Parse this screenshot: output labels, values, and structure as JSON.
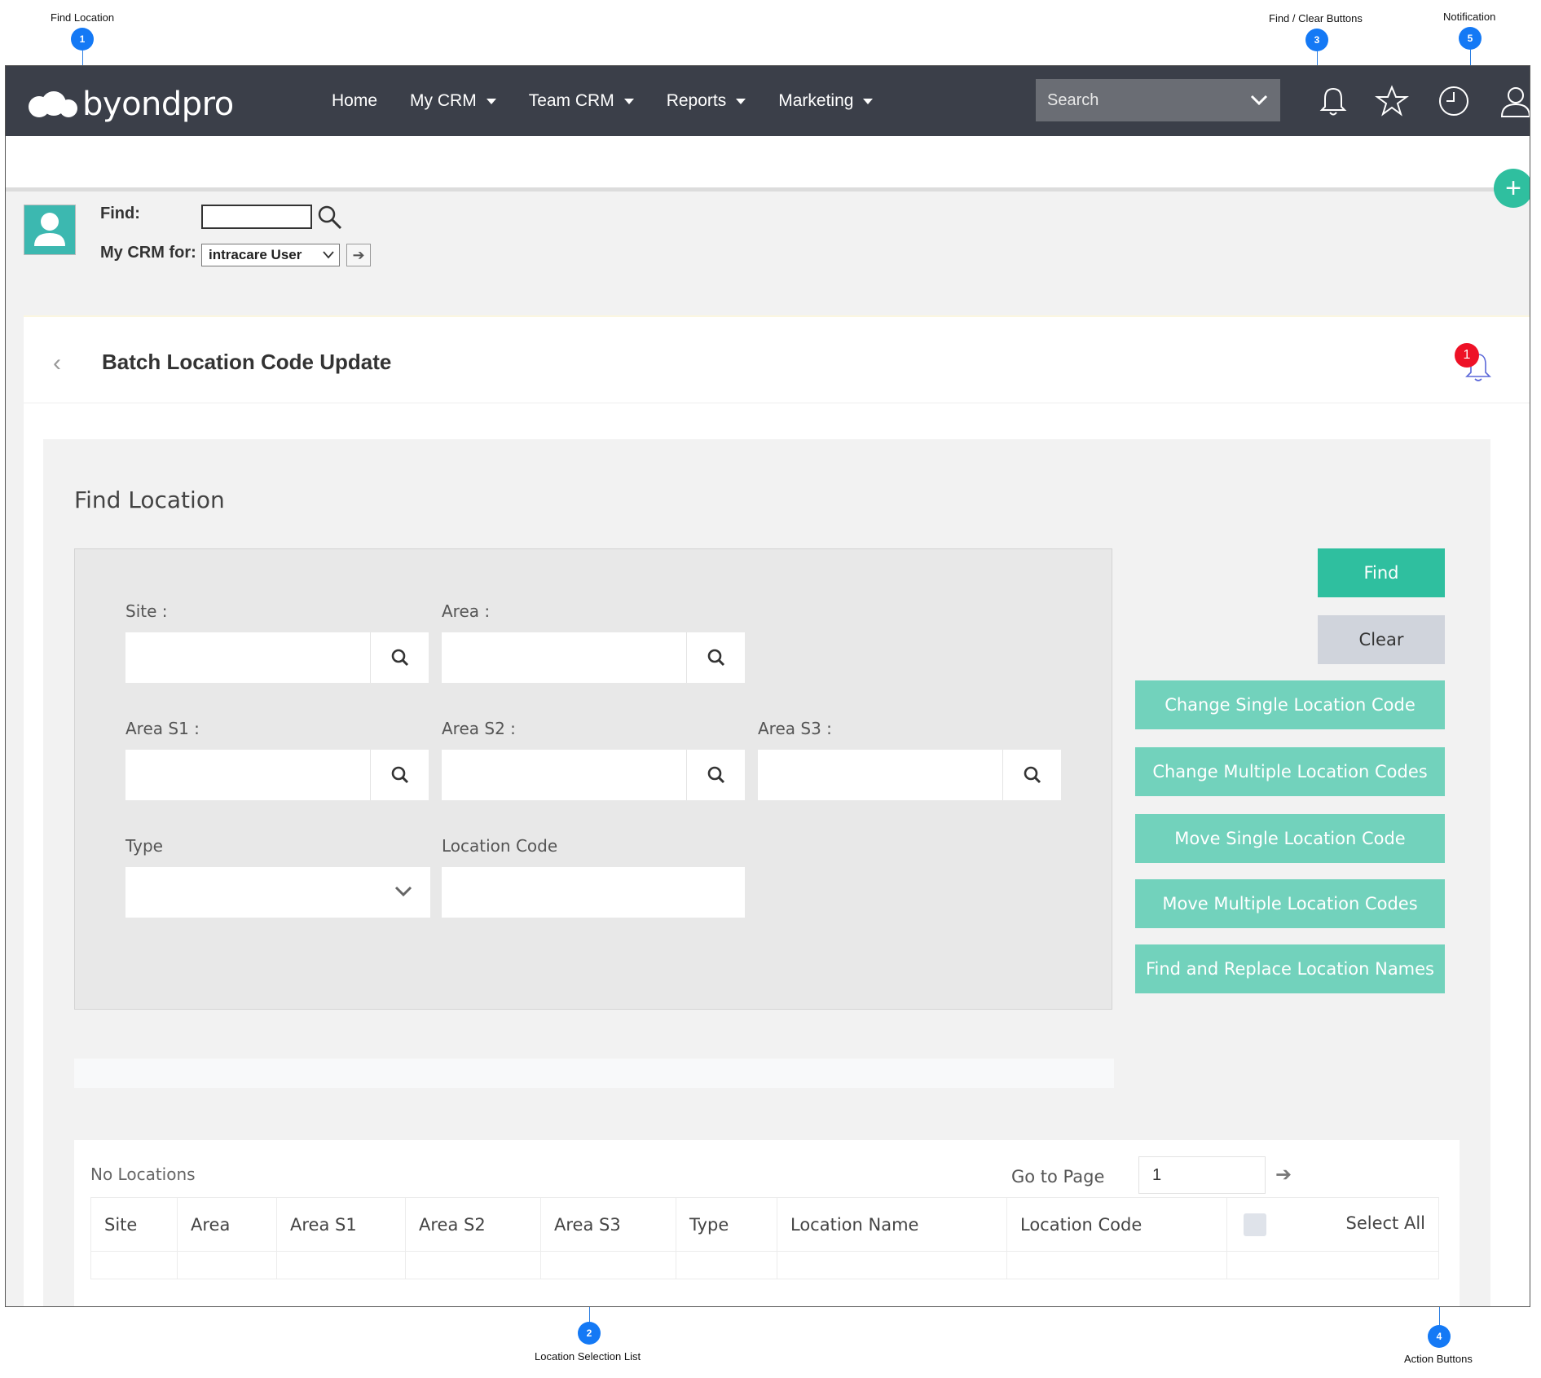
{
  "annotations": {
    "find_location": {
      "label": "Find Location",
      "num": "1"
    },
    "location_selection_list": {
      "label": "Location Selection List",
      "num": "2"
    },
    "find_clear_buttons": {
      "label": "Find  / Clear Buttons",
      "num": "3"
    },
    "action_buttons": {
      "label": "Action Buttons",
      "num": "4"
    },
    "notification": {
      "label": "Notification",
      "num": "5"
    }
  },
  "navbar": {
    "logo_text": "byondpro",
    "links": [
      "Home",
      "My CRM",
      "Team CRM",
      "Reports",
      "Marketing"
    ],
    "search_placeholder": "Search"
  },
  "toolbar": {
    "find_label": "Find:",
    "crm_for_label": "My CRM for:",
    "crm_for_value": "intracare User",
    "fab_icon": "plus-icon"
  },
  "page": {
    "title": "Batch Location Code Update",
    "notification_count": "1"
  },
  "find_location": {
    "title": "Find Location",
    "site_label": "Site :",
    "area_label": "Area :",
    "area_s1_label": "Area S1 :",
    "area_s2_label": "Area S2 :",
    "area_s3_label": "Area S3 :",
    "type_label": "Type",
    "location_code_label": "Location Code"
  },
  "buttons": {
    "find": "Find",
    "clear": "Clear",
    "change_single": "Change Single Location Code",
    "change_multiple": "Change Multiple Location Codes",
    "move_single": "Move Single Location Code",
    "move_multiple": "Move Multiple Location Codes",
    "find_replace": "Find and Replace Location Names"
  },
  "results": {
    "empty_text": "No Locations",
    "goto_label": "Go to Page",
    "page_value": "1",
    "columns": [
      "Site",
      "Area",
      "Area S1",
      "Area S2",
      "Area S3",
      "Type",
      "Location Name",
      "Location Code"
    ],
    "select_all": "Select All"
  },
  "colors": {
    "nav_bg": "#3b3f49",
    "primary": "#2fbf9f",
    "action": "#72d2bc",
    "clear": "#d0d4dc",
    "badge": "#ee1126",
    "callout": "#1479f5"
  }
}
